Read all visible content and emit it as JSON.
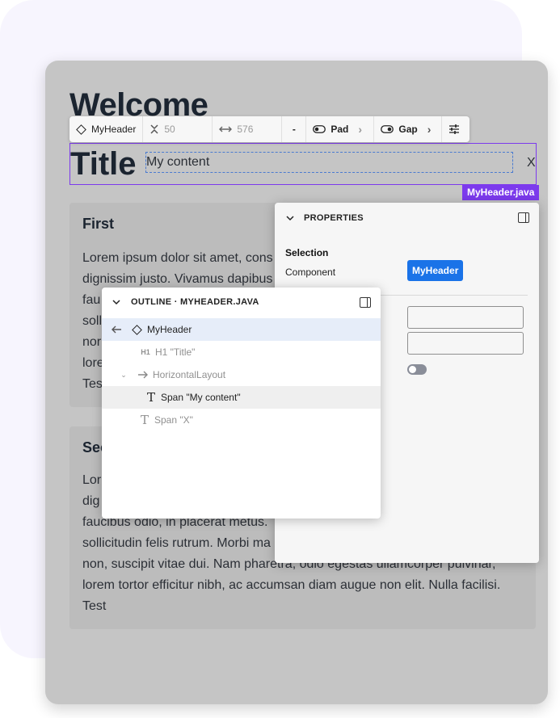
{
  "page": {
    "heading": "Welcome"
  },
  "toolbar": {
    "component": "MyHeader",
    "height_value": "50",
    "width_value": "576",
    "minus_label": "-",
    "pad_label": "Pad",
    "gap_label": "Gap"
  },
  "canvas": {
    "title": "Title",
    "content": "My content",
    "close_text": "X",
    "file_tag": "MyHeader.java"
  },
  "cards": [
    {
      "title": "First",
      "lines": [
        "Lorem ipsum dolor sit amet, cons",
        "dignissim justo. Vivamus dapibus",
        "fau",
        "soll",
        "nor",
        "lore",
        "Tes"
      ]
    },
    {
      "title": "Sec",
      "lines": [
        "Lor",
        "dig",
        "faucibus odio, in placerat metus.",
        "sollicitudin felis rutrum. Morbi ma",
        "non, suscipit vitae dui. Nam pharetra, odio egestas ullamcorper pulvinar,",
        "lorem tortor efficitur nibh, ac accumsan diam augue non elit. Nulla facilisi.",
        "Test"
      ]
    }
  ],
  "properties": {
    "title": "PROPERTIES",
    "selection_label": "Selection",
    "component_label": "Component",
    "component_value": "MyHeader"
  },
  "outline": {
    "title": "OUTLINE · MYHEADER.JAVA",
    "items": [
      {
        "label": "MyHeader",
        "icon": "diamond-icon"
      },
      {
        "label": "H1 \"Title\"",
        "icon": "h1-icon"
      },
      {
        "label": "HorizontalLayout",
        "icon": "arrow-right-icon"
      },
      {
        "label": "Span \"My content\"",
        "icon": "text-icon"
      },
      {
        "label": "Span \"X\"",
        "icon": "text-icon"
      }
    ]
  },
  "colors": {
    "accent": "#7c3aed",
    "primary": "#1a73e8",
    "selected_row": "#e6edf9"
  }
}
